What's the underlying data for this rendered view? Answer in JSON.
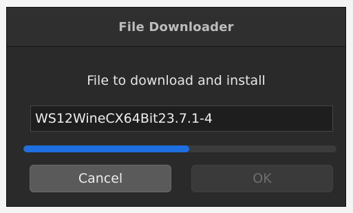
{
  "window": {
    "title": "File Downloader"
  },
  "dialog": {
    "prompt": "File to download and install",
    "filename": "WS12WineCX64Bit23.7.1-4",
    "progress_percent": 53
  },
  "buttons": {
    "cancel_label": "Cancel",
    "ok_label": "OK",
    "ok_enabled": false
  },
  "colors": {
    "window_bg": "#2a2a2a",
    "progress_fill": "#1f6fe0",
    "progress_track": "#3b3b3b",
    "cancel_bg": "#5a5a5a",
    "ok_bg_disabled": "#3a3a3a"
  }
}
